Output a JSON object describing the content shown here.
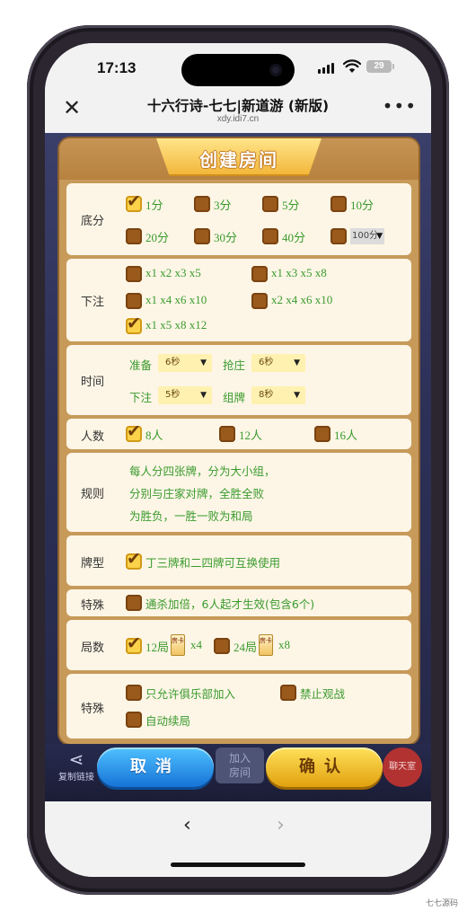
{
  "status": {
    "time": "17:13",
    "battery": "29"
  },
  "browser": {
    "title": "十六行诗-七七|新道游 (新版)",
    "url": "xdy.idi7.cn",
    "close_icon": "close-icon",
    "more_label": "•••",
    "back_icon": "chevron-left-icon",
    "forward_icon": "chevron-right-icon"
  },
  "dialog": {
    "title": "创建房间",
    "base_score": {
      "label": "底分",
      "options": [
        {
          "label": "1分",
          "checked": true
        },
        {
          "label": "3分",
          "checked": false
        },
        {
          "label": "5分",
          "checked": false
        },
        {
          "label": "10分",
          "checked": false
        },
        {
          "label": "20分",
          "checked": false
        },
        {
          "label": "30分",
          "checked": false
        },
        {
          "label": "40分",
          "checked": false
        },
        {
          "label": "100分",
          "checked": false,
          "dropdown": true
        }
      ]
    },
    "bet": {
      "label": "下注",
      "options": [
        {
          "label": "x1 x2 x3 x5",
          "checked": false
        },
        {
          "label": "x1 x3 x5 x8",
          "checked": false
        },
        {
          "label": "x1 x4 x6 x10",
          "checked": false
        },
        {
          "label": "x2 x4 x6 x10",
          "checked": false
        },
        {
          "label": "x1 x5 x8 x12",
          "checked": true
        }
      ]
    },
    "time": {
      "label": "时间",
      "prepare_label": "准备",
      "prepare_value": "6秒",
      "grab_label": "抢庄",
      "grab_value": "6秒",
      "bet_label": "下注",
      "bet_value": "5秒",
      "group_label": "组牌",
      "group_value": "8秒"
    },
    "players": {
      "label": "人数",
      "options": [
        {
          "label": "8人",
          "checked": true
        },
        {
          "label": "12人",
          "checked": false
        },
        {
          "label": "16人",
          "checked": false
        }
      ]
    },
    "rules": {
      "label": "规则",
      "lines": [
        "每人分四张牌，分为大小组，",
        "分别与庄家对牌，全胜全败",
        "为胜负，一胜一败为和局"
      ]
    },
    "card_type": {
      "label": "牌型",
      "option": "丁三牌和二四牌可互换使用",
      "checked": true
    },
    "special1": {
      "label": "特殊",
      "option": "通杀加倍，6人起才生效(包含6个)",
      "checked": false
    },
    "rounds": {
      "label": "局数",
      "options": [
        {
          "label": "12局",
          "cost": "x4",
          "checked": true
        },
        {
          "label": "24局",
          "cost": "x8",
          "checked": false
        }
      ],
      "tile_text": "房卡"
    },
    "special2": {
      "label": "特殊",
      "options": [
        {
          "label": "只允许俱乐部加入",
          "checked": false
        },
        {
          "label": "禁止观战",
          "checked": false
        },
        {
          "label": "自动续局",
          "checked": false
        }
      ]
    }
  },
  "bottom": {
    "share_label": "复制链接",
    "cancel_label": "取消",
    "join_label_1": "加入",
    "join_label_2": "房间",
    "confirm_label": "确认",
    "chat_label": "聊天室"
  },
  "watermark": "七七源码",
  "colors": {
    "green_text": "#3a9a2e",
    "checkbox": "#9a5a1c",
    "confirm": "#f3c02c",
    "cancel": "#2a8fe6"
  }
}
